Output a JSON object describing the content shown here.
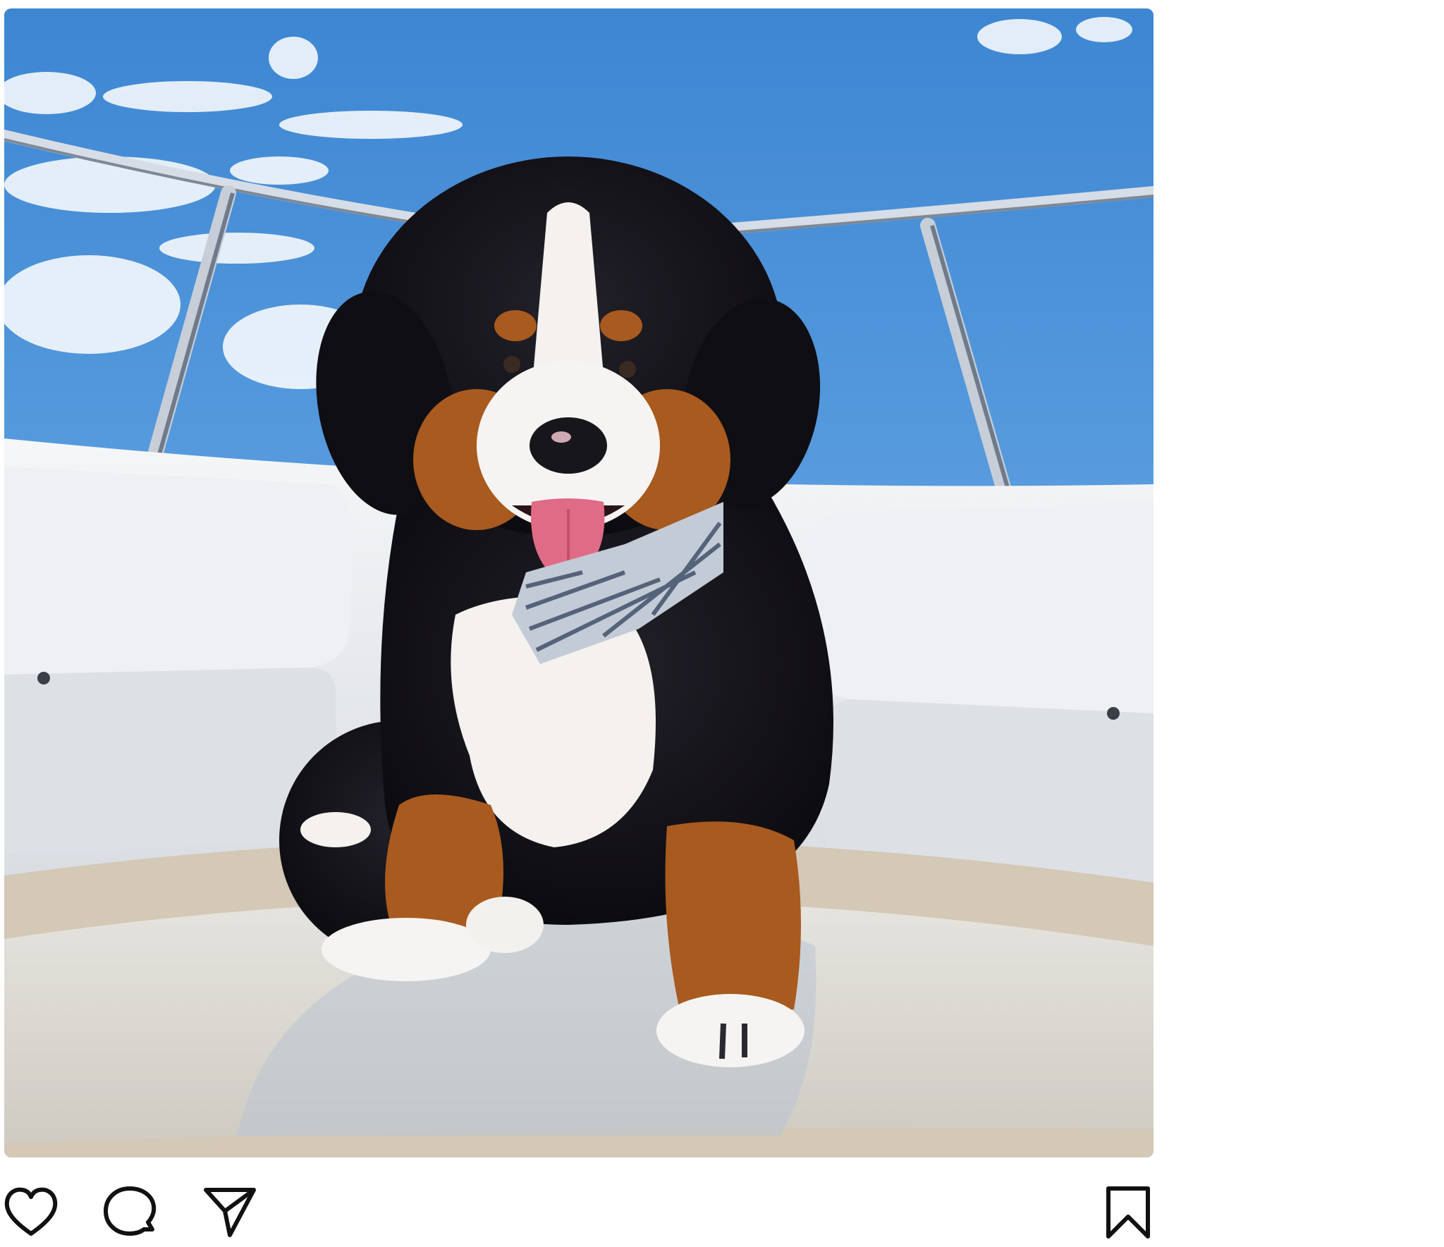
{
  "post": {
    "photo": {
      "subject": "bernese-mountain-dog-puppy",
      "colors": {
        "sky": "#4f93d8",
        "seat": "#eef0f2",
        "deck": "#d8cdbd",
        "fur_black": "#141318",
        "fur_tan": "#a85a1f",
        "fur_white": "#f4f1ee",
        "tongue": "#e06b86",
        "rail": "#c4ccd6"
      }
    },
    "actions": {
      "like_icon": "heart-icon",
      "comment_icon": "comment-icon",
      "share_icon": "paper-plane-icon",
      "save_icon": "bookmark-icon"
    }
  }
}
